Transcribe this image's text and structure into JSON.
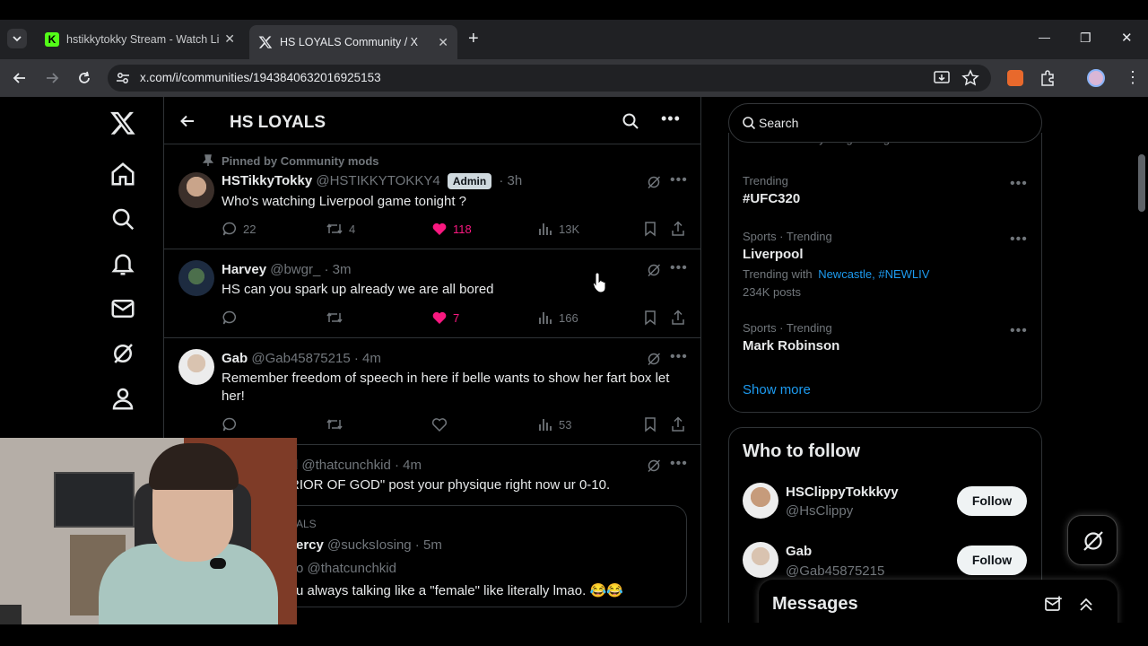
{
  "browser": {
    "tabs": [
      {
        "title": "hstikkytokky Stream - Watch Live",
        "favicon": "kick-icon",
        "close": "✕"
      },
      {
        "title": "HS LOYALS Community / X",
        "favicon": "x-icon",
        "close": "✕"
      }
    ],
    "new_tab": "+",
    "url": "x.com/i/communities/1943840632016925153",
    "window_controls": {
      "minimize": "—",
      "restore": "❐",
      "close": "✕"
    }
  },
  "header": {
    "title": "HS LOYALS"
  },
  "posts": [
    {
      "pinned_label": "Pinned by Community mods",
      "name": "HSTikkyTokky",
      "handle": "@HSTIKKYTOKKY4",
      "badge": "Admin",
      "time": "· 3h",
      "text": "Who's watching Liverpool game tonight ?",
      "replies": "22",
      "reposts": "4",
      "likes": "118",
      "views": "13K",
      "liked": true
    },
    {
      "name": "Harvey",
      "handle": "@bwgr_ · 3m",
      "text": "HS can you spark up already we are all bored",
      "replies": "",
      "reposts": "",
      "likes": "7",
      "views": "166",
      "liked": true
    },
    {
      "name": "Gab",
      "handle": "@Gab45875215 · 4m",
      "text": "Remember freedom of speech in here if belle wants to show her fart box let her!",
      "replies": "",
      "reposts": "",
      "likes": "",
      "views": "53",
      "liked": false
    },
    {
      "name": "d",
      "handle": "@thatcunchkid · 4m",
      "text": "RIOR OF GOD\" post your physique right now ur 0-10.",
      "quote": {
        "community": "ALS",
        "name": "ercy",
        "handle": "@sucksIosing · 5m",
        "reply_to": "o @thatcunchkid",
        "text": "u always talking like a \"female\" like literally lmao. 😂😂"
      }
    }
  ],
  "sidebar": {
    "search_placeholder": "Search",
    "promoted_fragment": "Promoted by Burger King",
    "trends": [
      {
        "meta": "Trending",
        "name": "#UFC320"
      },
      {
        "meta": "Sports · Trending",
        "name": "Liverpool",
        "with_label": "Trending with",
        "with_links": "Newcastle, #NEWLIV",
        "posts": "234K posts"
      },
      {
        "meta": "Sports · Trending",
        "name": "Mark Robinson"
      }
    ],
    "show_more": "Show more",
    "who_to_follow": {
      "title": "Who to follow",
      "users": [
        {
          "name": "HSClippyTokkkyy",
          "handle": "@HsClippy",
          "button": "Follow"
        },
        {
          "name": "Gab",
          "handle": "@Gab45875215",
          "button": "Follow"
        }
      ]
    },
    "messages_label": "Messages"
  },
  "colors": {
    "background": "#000000",
    "border": "#2f3336",
    "muted": "#71767b",
    "like_pink": "#f91880",
    "link_blue": "#1d9bf0",
    "chrome_dark": "#202124",
    "chrome_toolbar": "#35363a"
  }
}
